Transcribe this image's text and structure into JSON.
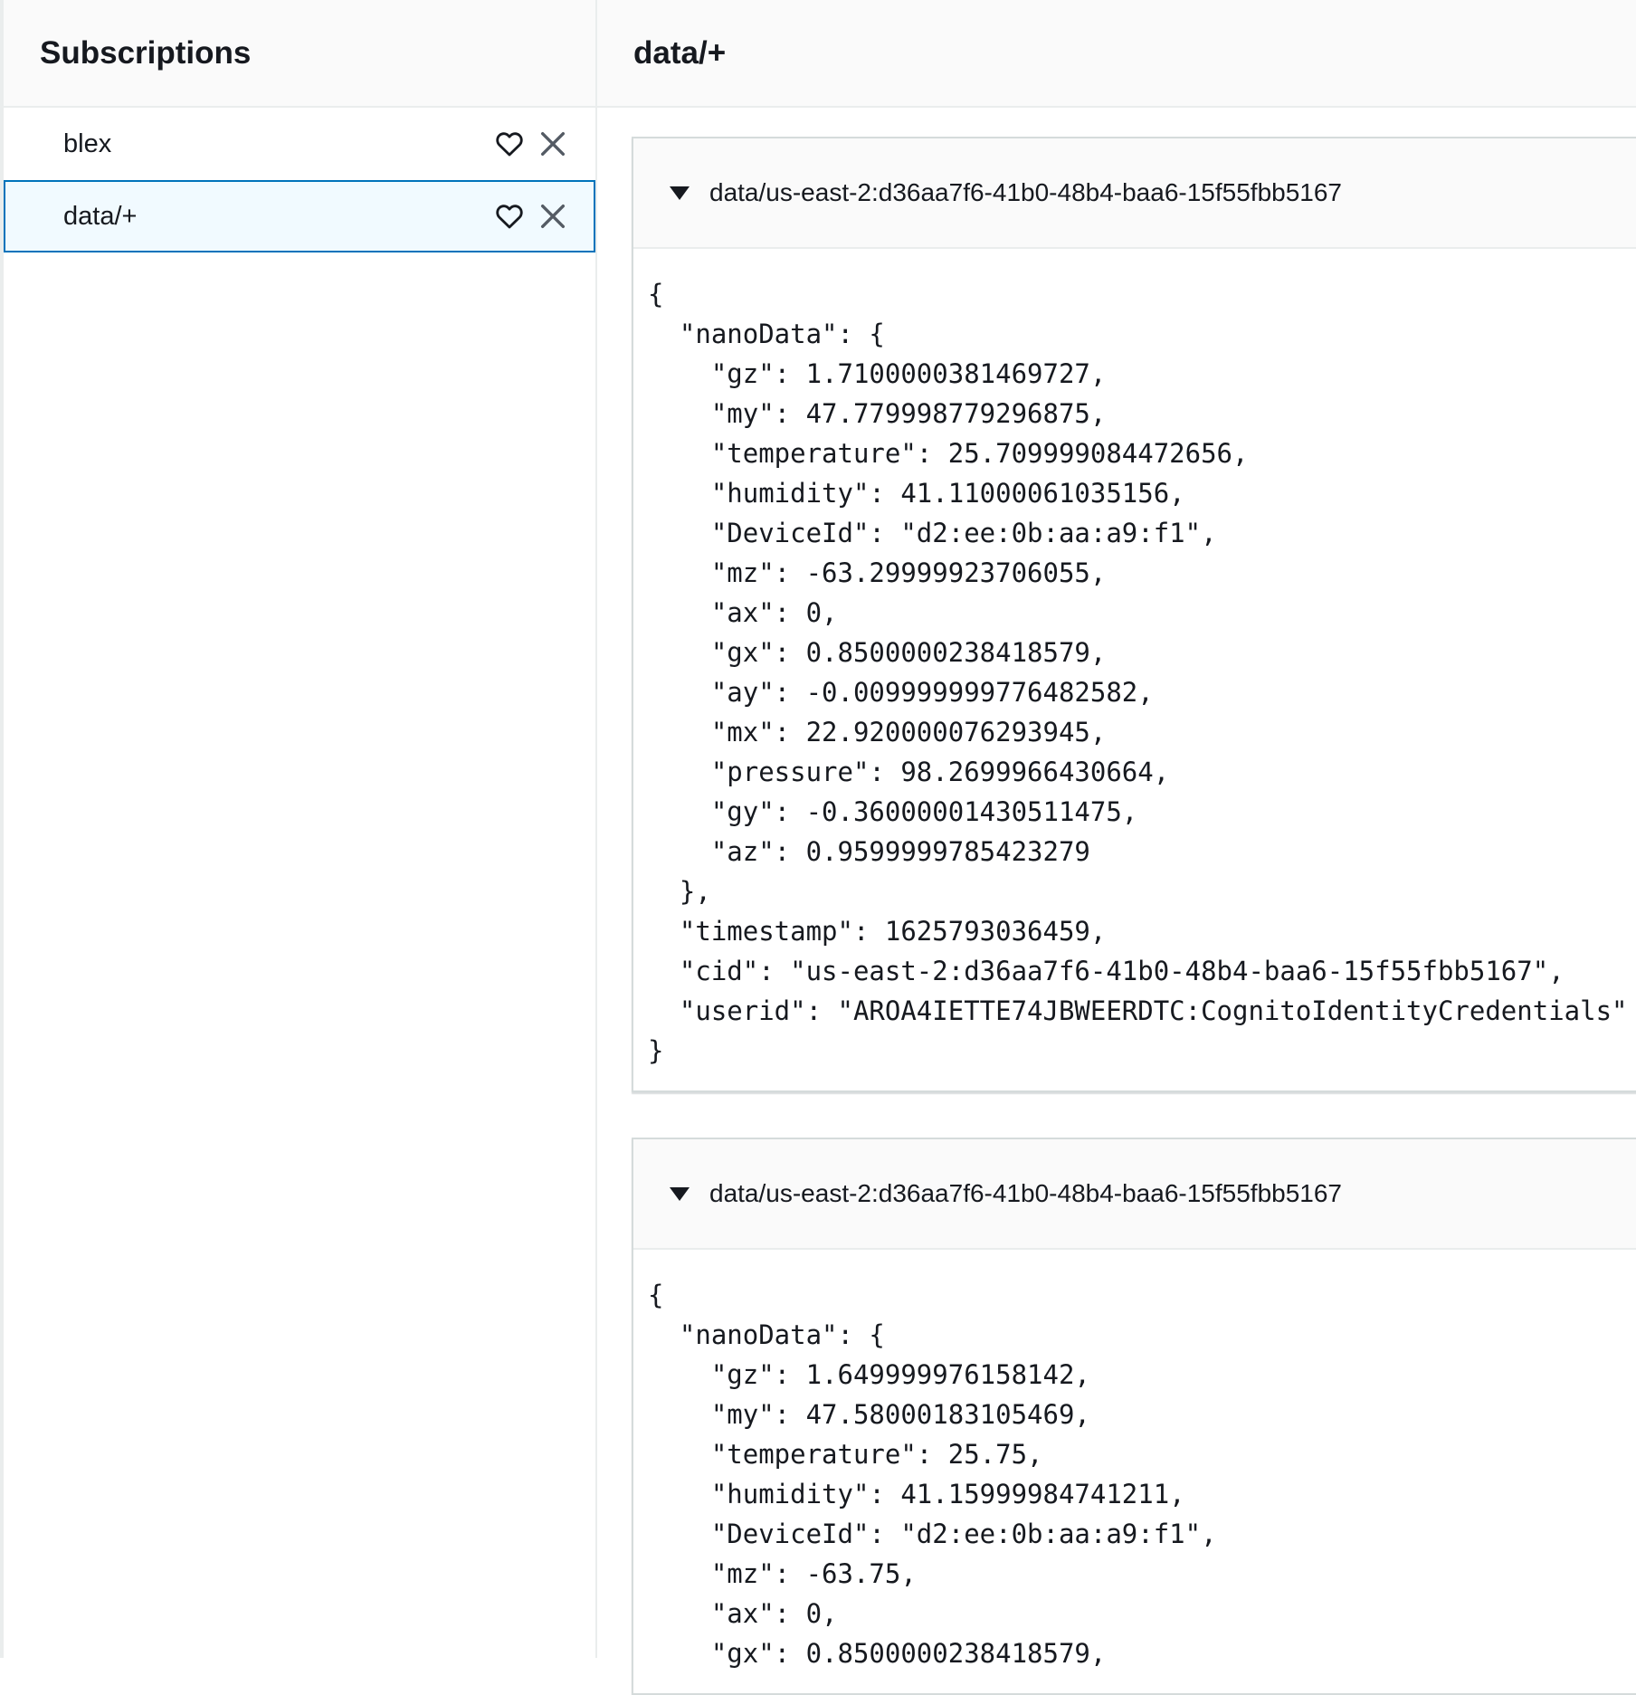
{
  "sidebar": {
    "title": "Subscriptions",
    "items": [
      {
        "label": "blex",
        "selected": false,
        "favorite_icon": "heart-icon",
        "remove_icon": "close-icon"
      },
      {
        "label": "data/+",
        "selected": true,
        "favorite_icon": "heart-icon",
        "remove_icon": "close-icon"
      }
    ]
  },
  "main": {
    "title": "data/+",
    "messages": [
      {
        "topic": "data/us-east-2:d36aa7f6-41b0-48b4-baa6-15f55fbb5167",
        "body": "{\n  \"nanoData\": {\n    \"gz\": 1.7100000381469727,\n    \"my\": 47.779998779296875,\n    \"temperature\": 25.709999084472656,\n    \"humidity\": 41.11000061035156,\n    \"DeviceId\": \"d2:ee:0b:aa:a9:f1\",\n    \"mz\": -63.29999923706055,\n    \"ax\": 0,\n    \"gx\": 0.8500000238418579,\n    \"ay\": -0.009999999776482582,\n    \"mx\": 22.920000076293945,\n    \"pressure\": 98.2699966430664,\n    \"gy\": -0.36000001430511475,\n    \"az\": 0.9599999785423279\n  },\n  \"timestamp\": 1625793036459,\n  \"cid\": \"us-east-2:d36aa7f6-41b0-48b4-baa6-15f55fbb5167\",\n  \"userid\": \"AROA4IETTE74JBWEERDTC:CognitoIdentityCredentials\"\n}"
      },
      {
        "topic": "data/us-east-2:d36aa7f6-41b0-48b4-baa6-15f55fbb5167",
        "body": "{\n  \"nanoData\": {\n    \"gz\": 1.649999976158142,\n    \"my\": 47.58000183105469,\n    \"temperature\": 25.75,\n    \"humidity\": 41.15999984741211,\n    \"DeviceId\": \"d2:ee:0b:aa:a9:f1\",\n    \"mz\": -63.75,\n    \"ax\": 0,\n    \"gx\": 0.8500000238418579,"
      }
    ]
  },
  "colors": {
    "selected_bg": "#f1faff",
    "selected_border": "#0073bb",
    "header_bg": "#fafafa"
  }
}
